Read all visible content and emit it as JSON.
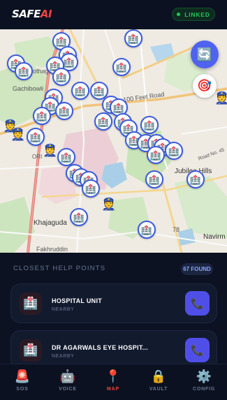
{
  "header": {
    "logo_main": "SAFE",
    "logo_accent": "AI",
    "status_label": "LINKED",
    "status_color": "#22c55e"
  },
  "map": {
    "labels": {
      "gachibowli": "Gachibowli",
      "rd_100": "100 Feet Road",
      "jubilee_hills": "Jubilee Hills",
      "khajaguda": "Khajaguda",
      "navirm": "Navirm",
      "fakhruddin": "Fakhruddin",
      "rd_78": "78",
      "road_no_45": "Road No. 45",
      "kothaguda": "othag",
      "ora": "ORI"
    },
    "refresh_icon": "refresh-icon",
    "locate_icon": "target-icon"
  },
  "help_points": {
    "title": "CLOSEST HELP POINTS",
    "count_label": "67 FOUND",
    "items": [
      {
        "name": "HOSPITAL UNIT",
        "distance": "NEARBY",
        "icon": "hospital-icon"
      },
      {
        "name": "DR AGARWALS EYE HOSPIT...",
        "distance": "NEARBY",
        "icon": "hospital-icon"
      }
    ]
  },
  "nav": {
    "items": [
      {
        "label": "SOS",
        "icon": "siren-icon"
      },
      {
        "label": "VOICE",
        "icon": "robot-icon"
      },
      {
        "label": "MAP",
        "icon": "pin-icon",
        "active": true
      },
      {
        "label": "VAULT",
        "icon": "lock-icon"
      },
      {
        "label": "CONFIG",
        "icon": "gear-icon"
      }
    ]
  },
  "colors": {
    "accent": "#4f4fe8",
    "danger": "#ef4444",
    "background": "#0c1222"
  }
}
